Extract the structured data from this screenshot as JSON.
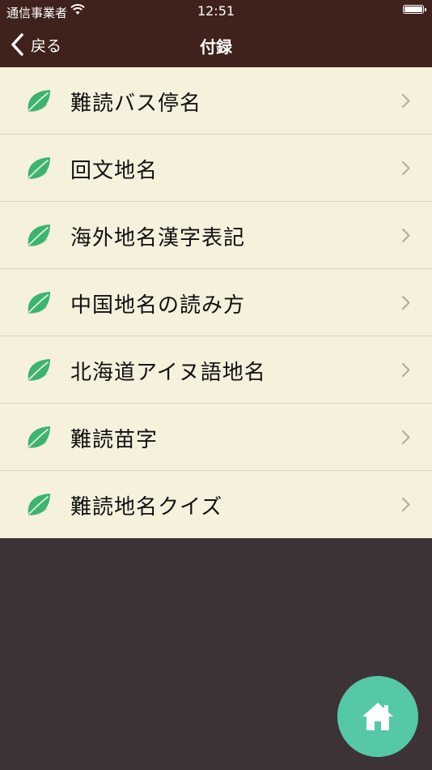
{
  "status": {
    "carrier": "通信事業者",
    "time": "12:51"
  },
  "nav": {
    "back_label": "戻る",
    "title": "付録"
  },
  "list": {
    "items": [
      {
        "label": "難読バス停名"
      },
      {
        "label": "回文地名"
      },
      {
        "label": "海外地名漢字表記"
      },
      {
        "label": "中国地名の読み方"
      },
      {
        "label": "北海道アイヌ語地名"
      },
      {
        "label": "難読苗字"
      },
      {
        "label": "難読地名クイズ"
      }
    ]
  },
  "icons": {
    "row_icon": "leaf-icon",
    "row_chevron": "chevron-right-icon",
    "fab": "home-icon"
  },
  "colors": {
    "bar": "#3f221c",
    "list_bg": "#f5f1dd",
    "page_bg": "#3d3336",
    "leaf": "#3cb371",
    "fab": "#55c8a8"
  }
}
